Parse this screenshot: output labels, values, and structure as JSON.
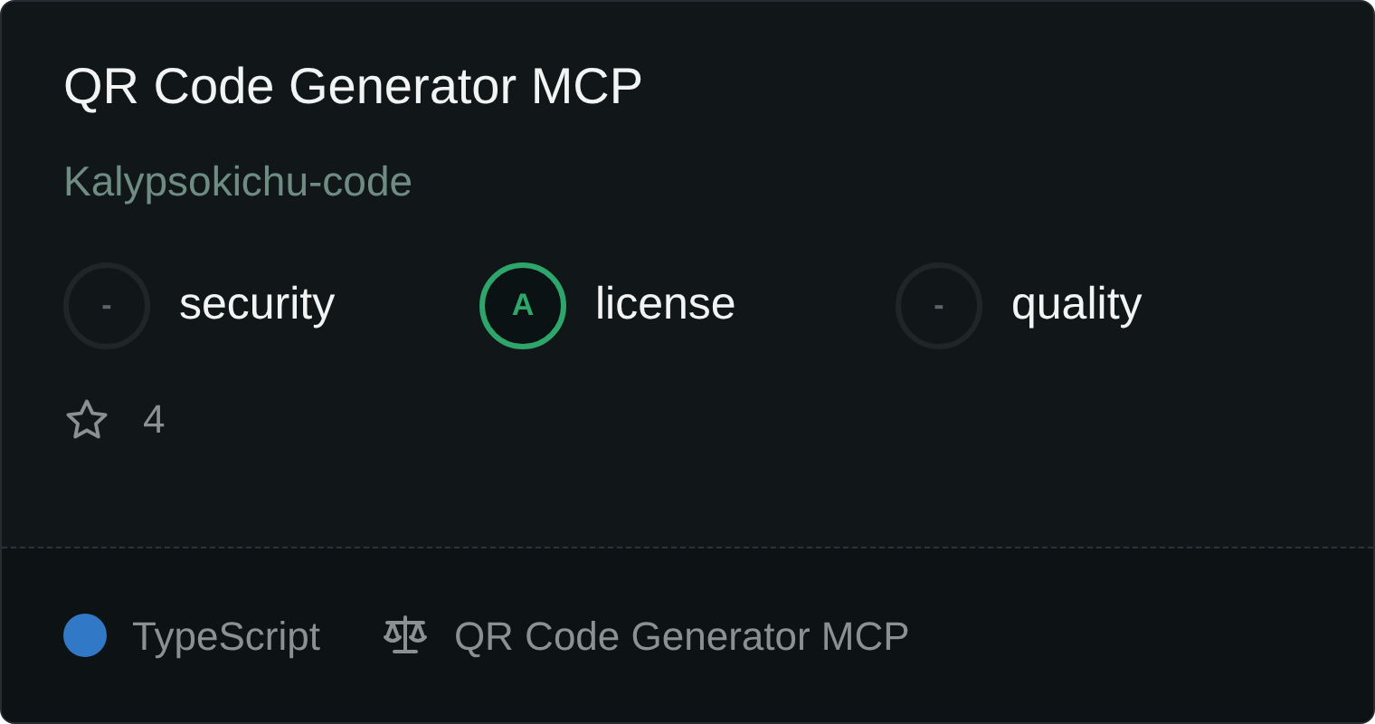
{
  "title": "QR Code Generator MCP",
  "author": "Kalypsokichu-code",
  "scores": [
    {
      "grade": "-",
      "label": "security",
      "graded": false
    },
    {
      "grade": "A",
      "label": "license",
      "graded": true
    },
    {
      "grade": "-",
      "label": "quality",
      "graded": false
    }
  ],
  "stars": "4",
  "footer": {
    "language": {
      "name": "TypeScript",
      "color": "#3178c6"
    },
    "license": "QR Code Generator MCP"
  }
}
